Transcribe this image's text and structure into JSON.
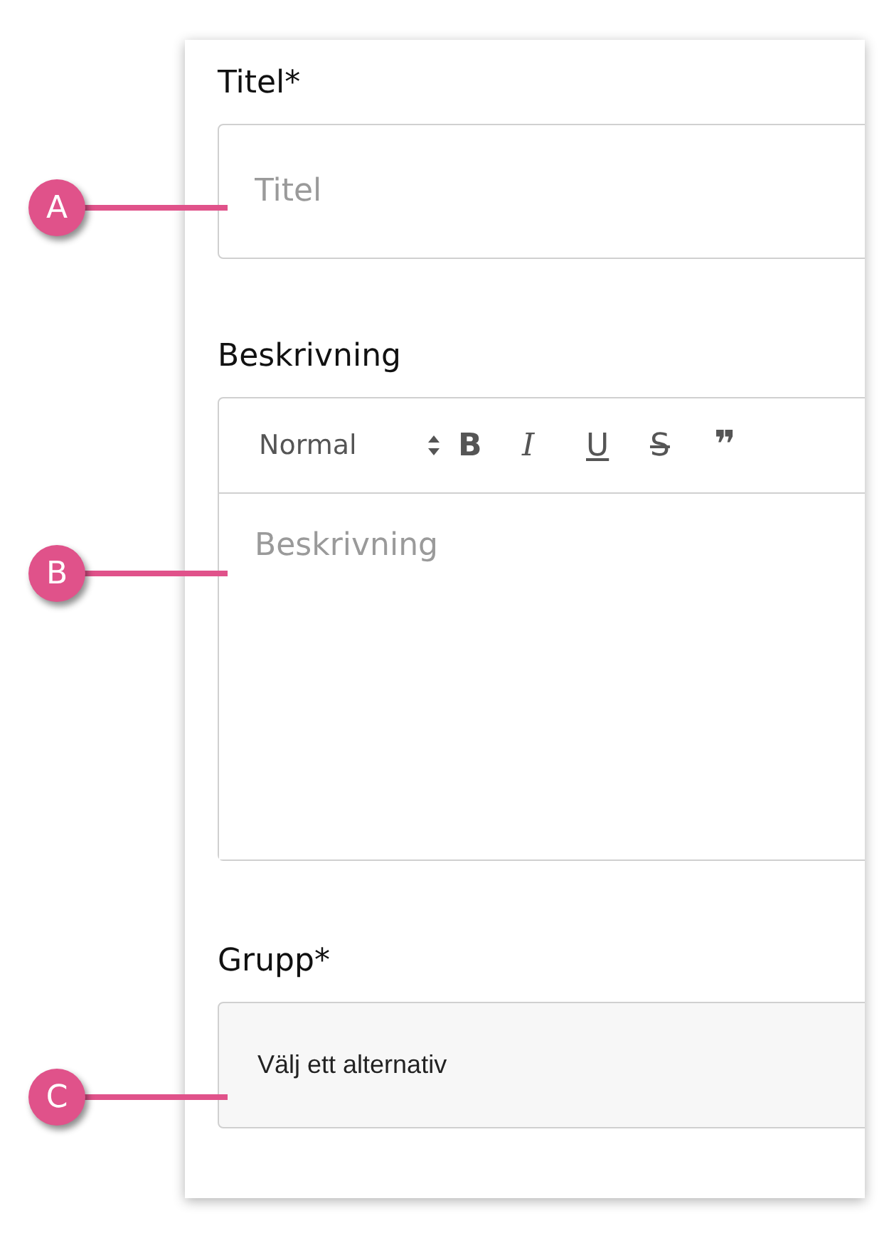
{
  "fields": [
    {
      "kind": "input",
      "label": "Titel*",
      "placeholder": "Titel",
      "marker": "A"
    },
    {
      "kind": "editor",
      "label": "Beskrivning",
      "placeholder": "Beskrivning",
      "marker": "B",
      "format": "Normal",
      "toolbar": [
        {
          "kind": "bold",
          "label": "B"
        },
        {
          "kind": "italic",
          "label": "I"
        },
        {
          "kind": "underline",
          "label": "U"
        },
        {
          "kind": "strike",
          "label": "S"
        },
        {
          "kind": "quote",
          "label": "❞"
        }
      ]
    },
    {
      "kind": "select",
      "label": "Grupp*",
      "value": "Välj ett alternativ",
      "marker": "C"
    }
  ]
}
